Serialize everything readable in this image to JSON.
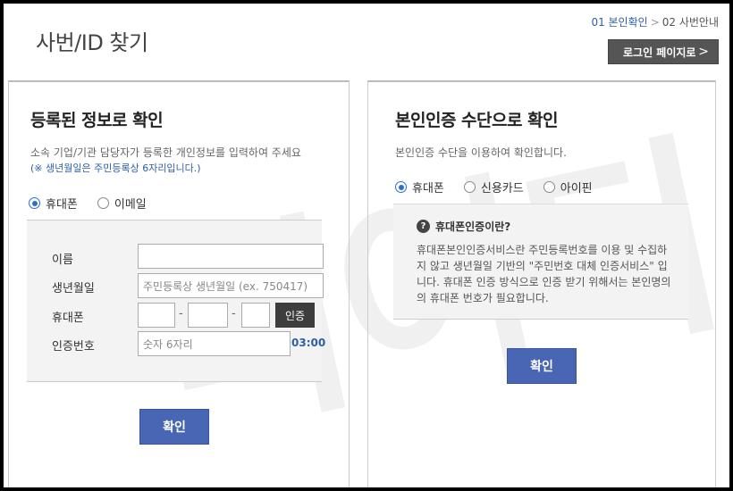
{
  "page": {
    "title": "사번/ID 찾기"
  },
  "steps": {
    "step1": "01 본인확인",
    "separator": ">",
    "step2": "02 사번안내"
  },
  "login_button": {
    "label": "로그인 페이지로",
    "chevron": ">"
  },
  "left_panel": {
    "heading": "등록된 정보로 확인",
    "description": "소속 기업/기관 담당자가 등록한 개인정보를 입력하여 주세요",
    "note": "(※ 생년월일은 주민등록상 6자리입니다.)",
    "radios": [
      {
        "label": "휴대폰",
        "checked": true
      },
      {
        "label": "이메일",
        "checked": false
      }
    ],
    "form": {
      "name_label": "이름",
      "name_value": "",
      "birth_label": "생년월일",
      "birth_placeholder": "주민등록상 생년월일 (ex. 750417)",
      "phone_label": "휴대폰",
      "phone_dash": "-",
      "phone_parts": [
        "",
        "",
        ""
      ],
      "auth_button": "인증",
      "code_label": "인증번호",
      "code_placeholder": "숫자 6자리",
      "timer": "03:00"
    },
    "confirm": "확인"
  },
  "right_panel": {
    "heading": "본인인증 수단으로 확인",
    "description": "본인인증 수단을 이용하여 확인합니다.",
    "radios": [
      {
        "label": "휴대폰",
        "checked": true
      },
      {
        "label": "신용카드",
        "checked": false
      },
      {
        "label": "아이핀",
        "checked": false
      }
    ],
    "info": {
      "icon": "question-icon",
      "title": "휴대폰인증이란?",
      "text": "휴대폰본인인증서비스란 주민등록번호를 이용 및 수집하지 않고 생년월일 기반의 \"주민번호 대체 인증서비스\" 입니다. 휴대폰 인증 방식으로 인증 받기 위해서는 본인명의의 휴대폰 번호가 필요합니다."
    },
    "confirm": "확인"
  },
  "watermark": "니어티"
}
